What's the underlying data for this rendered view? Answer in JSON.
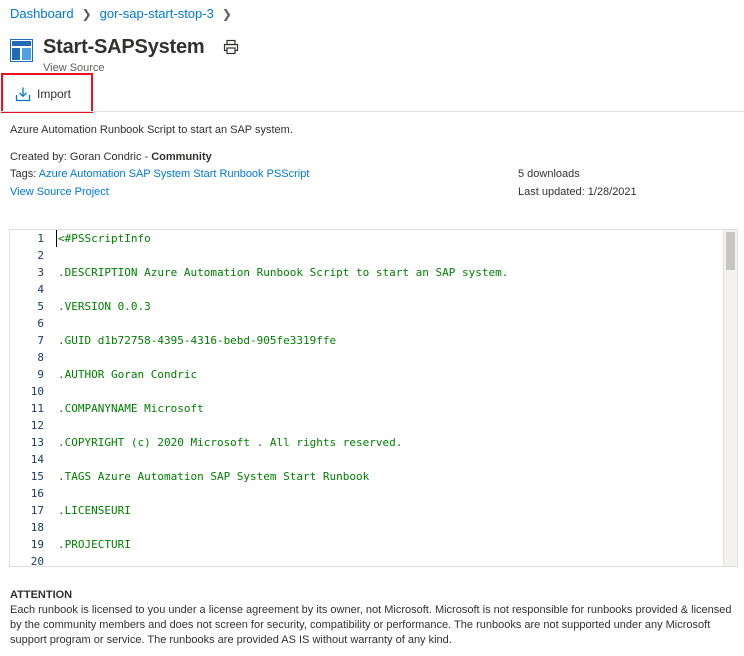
{
  "breadcrumb": {
    "items": [
      "Dashboard",
      "gor-sap-start-stop-3"
    ],
    "separator": ">"
  },
  "header": {
    "title": "Start-SAPSystem",
    "subtitle": "View Source"
  },
  "toolbar": {
    "import_label": "Import"
  },
  "details": {
    "description": "Azure Automation Runbook Script to start an SAP system.",
    "created_by_prefix": "Created by: Goran Condric - ",
    "created_by_type": "Community",
    "tags_prefix": "Tags: ",
    "tags": "Azure Automation SAP System Start Runbook PSScript",
    "view_source_project": "View Source Project",
    "downloads": "5 downloads",
    "last_updated": "Last updated: 1/28/2021"
  },
  "code": {
    "lines": [
      {
        "n": "1",
        "t": "<#PSScriptInfo"
      },
      {
        "n": "2",
        "t": ""
      },
      {
        "n": "3",
        "t": ".DESCRIPTION Azure Automation Runbook Script to start an SAP system."
      },
      {
        "n": "4",
        "t": ""
      },
      {
        "n": "5",
        "t": ".VERSION 0.0.3"
      },
      {
        "n": "6",
        "t": ""
      },
      {
        "n": "7",
        "t": ".GUID d1b72758-4395-4316-bebd-905fe3319ffe"
      },
      {
        "n": "8",
        "t": ""
      },
      {
        "n": "9",
        "t": ".AUTHOR Goran Condric"
      },
      {
        "n": "10",
        "t": ""
      },
      {
        "n": "11",
        "t": ".COMPANYNAME Microsoft"
      },
      {
        "n": "12",
        "t": ""
      },
      {
        "n": "13",
        "t": ".COPYRIGHT (c) 2020 Microsoft . All rights reserved."
      },
      {
        "n": "14",
        "t": ""
      },
      {
        "n": "15",
        "t": ".TAGS Azure Automation SAP System Start Runbook"
      },
      {
        "n": "16",
        "t": ""
      },
      {
        "n": "17",
        "t": ".LICENSEURI"
      },
      {
        "n": "18",
        "t": ""
      },
      {
        "n": "19",
        "t": ".PROJECTURI"
      },
      {
        "n": "20",
        "t": ""
      }
    ]
  },
  "attention": {
    "title": "ATTENTION",
    "text": "Each runbook is licensed to you under a license agreement by its owner, not Microsoft. Microsoft is not responsible for runbooks provided & licensed by the community members and does not screen for security, compatibility or performance. The runbooks are not supported under any Microsoft support program or service. The runbooks are provided AS IS without warranty of any kind."
  },
  "colors": {
    "link": "#0078d4",
    "code_text": "#008000",
    "line_number": "#1b3a6b",
    "highlight_border": "#e81123"
  },
  "icons": {
    "runbook": "runbook-icon",
    "print": "print-icon",
    "import": "import-icon",
    "chevron": "chevron-right-icon"
  }
}
